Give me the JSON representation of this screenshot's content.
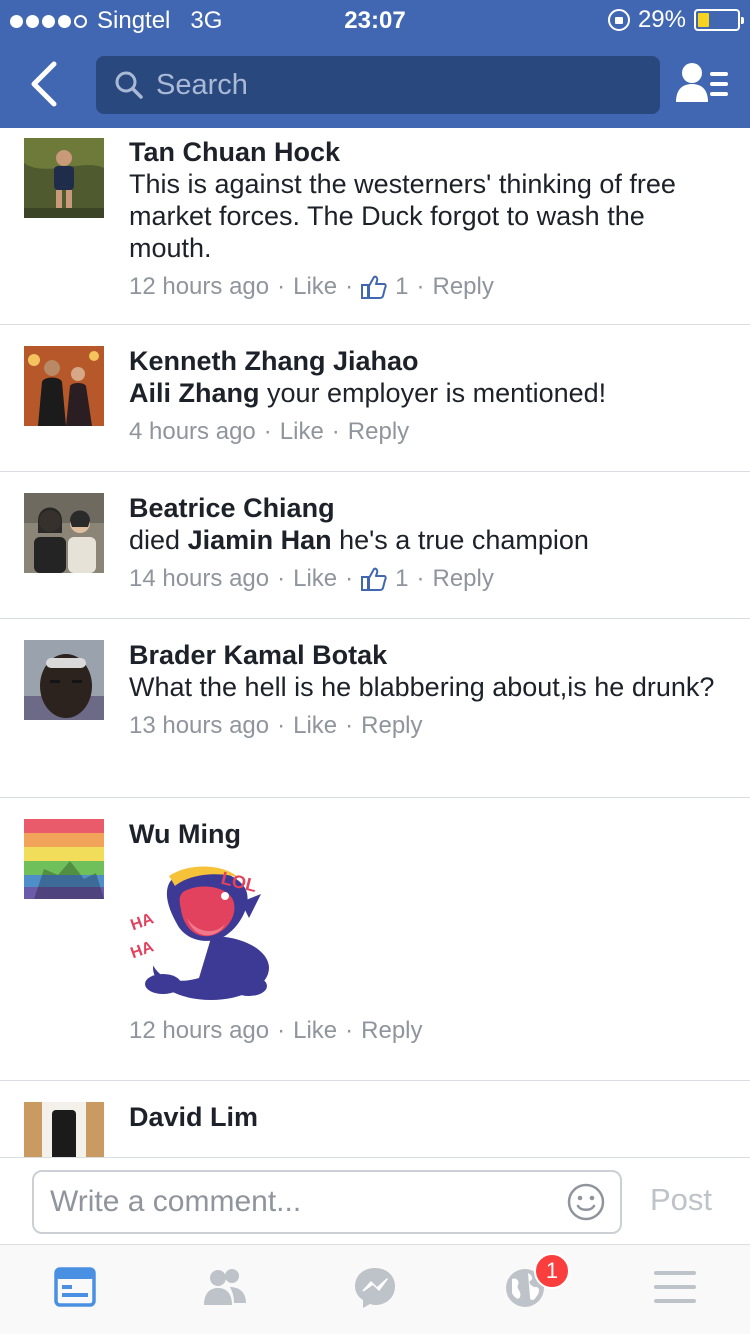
{
  "status_bar": {
    "carrier": "Singtel",
    "network": "3G",
    "time": "23:07",
    "battery": "29%",
    "battery_level": 0.29
  },
  "nav": {
    "search_placeholder": "Search"
  },
  "comments": [
    {
      "author": "Tan Chuan Hock",
      "text": "This is against the westerners' thinking of free market forces. The Duck forgot to wash the mouth.",
      "time": "12 hours ago",
      "like_label": "Like",
      "like_count": "1",
      "reply_label": "Reply"
    },
    {
      "author": "Kenneth Zhang Jiahao",
      "mention": "Aili Zhang",
      "text": " your employer is mentioned!",
      "time": "4 hours ago",
      "like_label": "Like",
      "reply_label": "Reply"
    },
    {
      "author": "Beatrice Chiang",
      "text_pre": "died ",
      "mention": "Jiamin Han",
      "text": " he's a true champion",
      "time": "14 hours ago",
      "like_label": "Like",
      "like_count": "1",
      "reply_label": "Reply"
    },
    {
      "author": "Brader Kamal Botak",
      "text": "What the hell is he blabbering about,is he drunk?",
      "time": "13 hours ago",
      "like_label": "Like",
      "reply_label": "Reply"
    },
    {
      "author": "Wu Ming",
      "sticker_text": [
        "LOL",
        "HA",
        "HA"
      ],
      "time": "12 hours ago",
      "like_label": "Like",
      "reply_label": "Reply"
    },
    {
      "author": "David Lim"
    }
  ],
  "composer": {
    "placeholder": "Write a comment...",
    "post_label": "Post"
  },
  "tabbar": {
    "notification_badge": "1"
  },
  "colors": {
    "header_blue": "#4267b2",
    "search_blue": "#29487d",
    "active_tab": "#4a90e2",
    "inactive_tab": "#bec3c9",
    "badge_red": "#fa3e3e"
  }
}
